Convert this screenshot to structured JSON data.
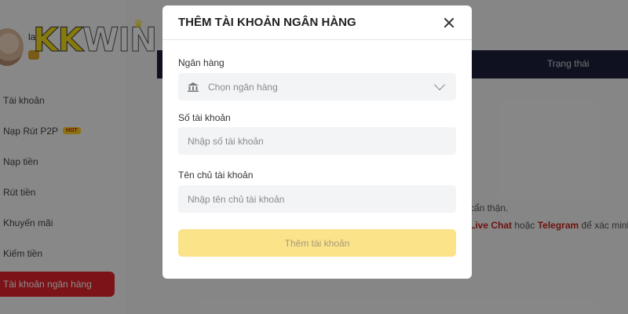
{
  "brand": {
    "logo_part1": "KK",
    "logo_part2": "WIN"
  },
  "user": {
    "name_fragment": "la"
  },
  "sidebar": {
    "items": [
      {
        "label": "Tài khoản"
      },
      {
        "label": "Nạp Rút P2P",
        "badge": "HOT"
      },
      {
        "label": "Nạp tiền"
      },
      {
        "label": "Rút tiền"
      },
      {
        "label": "Khuyến mãi"
      },
      {
        "label": "Kiếm tiền"
      },
      {
        "label": "Tài khoản ngân hàng"
      }
    ]
  },
  "table": {
    "status_header": "Trạng thái"
  },
  "notes": {
    "line1": "cẩn thận.",
    "line2_link1": "Live Chat",
    "line2_mid": " hoặc ",
    "line2_link2": "Telegram",
    "line2_end": " để xác minh"
  },
  "modal": {
    "title": "THÊM TÀI KHOẢN NGÂN HÀNG",
    "bank_label": "Ngân hàng",
    "bank_placeholder": "Chọn ngân hàng",
    "account_number_label": "Số tài khoản",
    "account_number_placeholder": "Nhập số tài khoản",
    "account_holder_label": "Tên chủ tài khoản",
    "account_holder_placeholder": "Nhập tên chủ tài khoản",
    "submit_label": "Thêm tài khoản"
  },
  "colors": {
    "accent_red": "#e0242d",
    "button_yellow": "#fbe38a",
    "dark_bar": "#1d1f3b"
  }
}
